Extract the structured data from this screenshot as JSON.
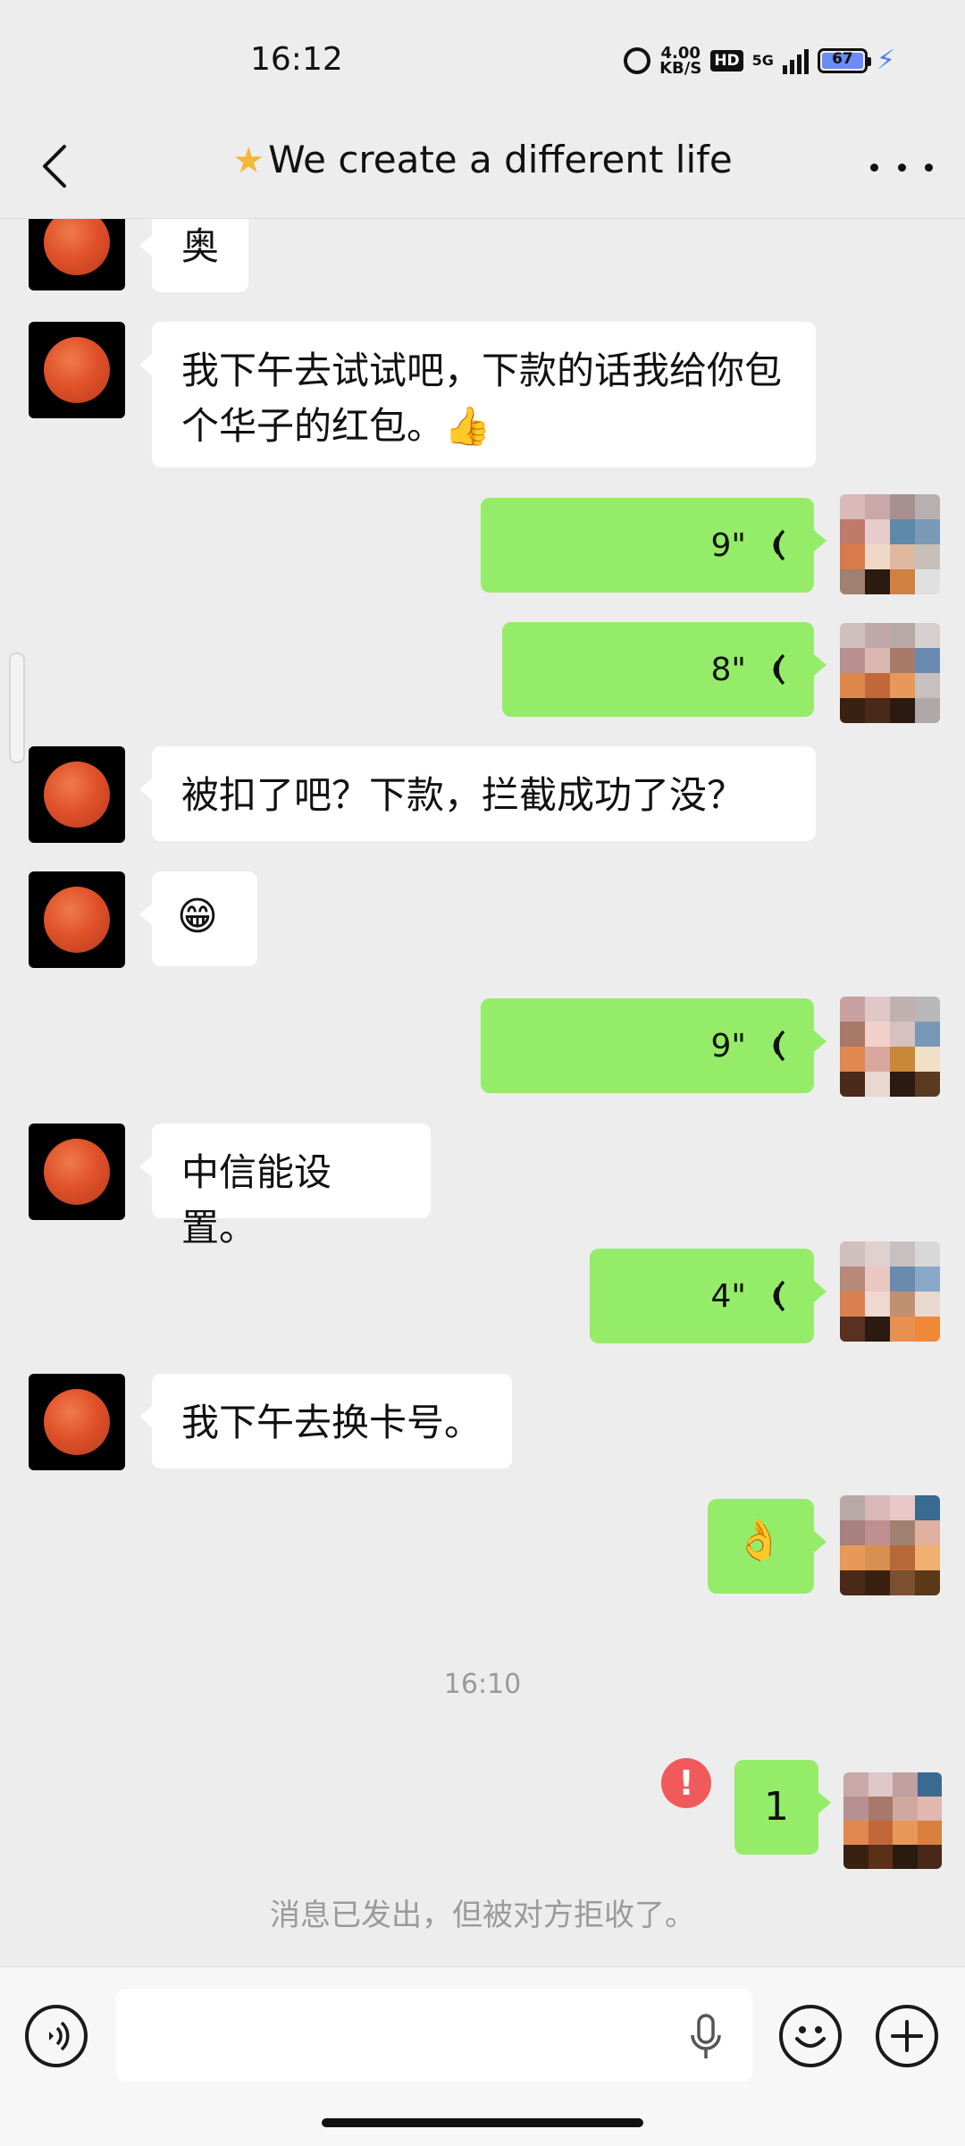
{
  "status_bar": {
    "time": "16:12",
    "net_speed_value": "4.00",
    "net_speed_unit": "KB/S",
    "hd": "HD",
    "network": "5G",
    "battery": "67"
  },
  "header": {
    "title": "We create a different life",
    "title_star_icon": "star-icon"
  },
  "messages": [
    {
      "side": "left",
      "type": "text",
      "text": "奥"
    },
    {
      "side": "left",
      "type": "text",
      "text": "我下午去试试吧，下款的话我给你包个华子的红包。👍"
    },
    {
      "side": "right",
      "type": "voice",
      "duration": "9\""
    },
    {
      "side": "right",
      "type": "voice",
      "duration": "8\""
    },
    {
      "side": "left",
      "type": "text",
      "text": "被扣了吧？下款，拦截成功了没？"
    },
    {
      "side": "left",
      "type": "emoji",
      "text": "😁"
    },
    {
      "side": "right",
      "type": "voice",
      "duration": "9\""
    },
    {
      "side": "left",
      "type": "text",
      "text": "中信能设置。"
    },
    {
      "side": "right",
      "type": "voice",
      "duration": "4\""
    },
    {
      "side": "left",
      "type": "text",
      "text": "我下午去换卡号。"
    },
    {
      "side": "right",
      "type": "emoji",
      "text": "👌"
    }
  ],
  "timestamp": "16:10",
  "last_message": {
    "side": "right",
    "type": "text",
    "text": "1",
    "error_mark": "!"
  },
  "system_notice": "消息已发出，但被对方拒收了。",
  "input": {
    "placeholder": "",
    "value": ""
  },
  "colors": {
    "background": "#ededed",
    "bubble_me": "#95ec69",
    "bubble_other": "#ffffff",
    "error": "#f15a5a"
  }
}
